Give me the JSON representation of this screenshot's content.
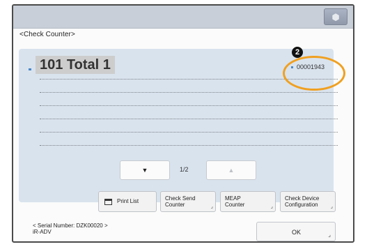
{
  "title": "<Check Counter>",
  "counter": {
    "name": "101 Total 1",
    "value": "00001943"
  },
  "callout": "2",
  "pagination": {
    "prev_icon": "down-arrow-icon",
    "next_icon": "up-arrow-icon",
    "page": "1/2"
  },
  "actions": {
    "print_list": "Print List",
    "check_send_counter": "Check Send\nCounter",
    "meap_counter": "MEAP\nCounter",
    "check_device_configuration": "Check Device\nConfiguration"
  },
  "footer": {
    "serial_label": "< Serial Number: DZK00020 >",
    "model": "iR-ADV",
    "ok": "OK"
  },
  "colors": {
    "panel": "#d9e3ee",
    "topbar": "#c9cfd8",
    "highlight": "#f0a020"
  }
}
